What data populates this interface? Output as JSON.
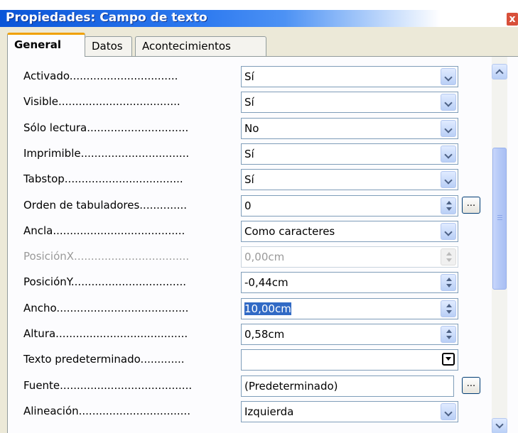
{
  "window": {
    "title": "Propiedades: Campo de texto",
    "close_glyph": "x"
  },
  "tabs": [
    {
      "label": "General",
      "active": true
    },
    {
      "label": "Datos",
      "active": false
    },
    {
      "label": "Acontecimientos",
      "active": false
    }
  ],
  "properties": [
    {
      "label": "Activado................................",
      "value": "Sí",
      "control": "dropdown"
    },
    {
      "label": "Visible....................................",
      "value": "Sí",
      "control": "dropdown"
    },
    {
      "label": "Sólo lectura..............................",
      "value": "No",
      "control": "dropdown"
    },
    {
      "label": "Imprimible................................",
      "value": "Sí",
      "control": "dropdown"
    },
    {
      "label": "Tabstop...................................",
      "value": "Sí",
      "control": "dropdown"
    },
    {
      "label": "Orden de tabuladores..............",
      "value": "0",
      "control": "spin",
      "dots_button": "..."
    },
    {
      "label": "Ancla.......................................",
      "value": "Como caracteres",
      "control": "dropdown"
    },
    {
      "label": "PosiciónX..................................",
      "value": "0,00cm",
      "control": "spin",
      "disabled": true
    },
    {
      "label": "PosiciónY..................................",
      "value": "-0,44cm",
      "control": "spin"
    },
    {
      "label": "Ancho.......................................",
      "value": "10,00cm",
      "control": "spin",
      "selected": true
    },
    {
      "label": "Altura.......................................",
      "value": "0,58cm",
      "control": "spin"
    },
    {
      "label": "Texto predeterminado.............",
      "value": "",
      "control": "combo"
    },
    {
      "label": "Fuente.......................................",
      "value": "(Predeterminado)",
      "control": "dots",
      "dots_button": "..."
    },
    {
      "label": "Alineación.................................",
      "value": "Izquierda",
      "control": "dropdown"
    }
  ]
}
